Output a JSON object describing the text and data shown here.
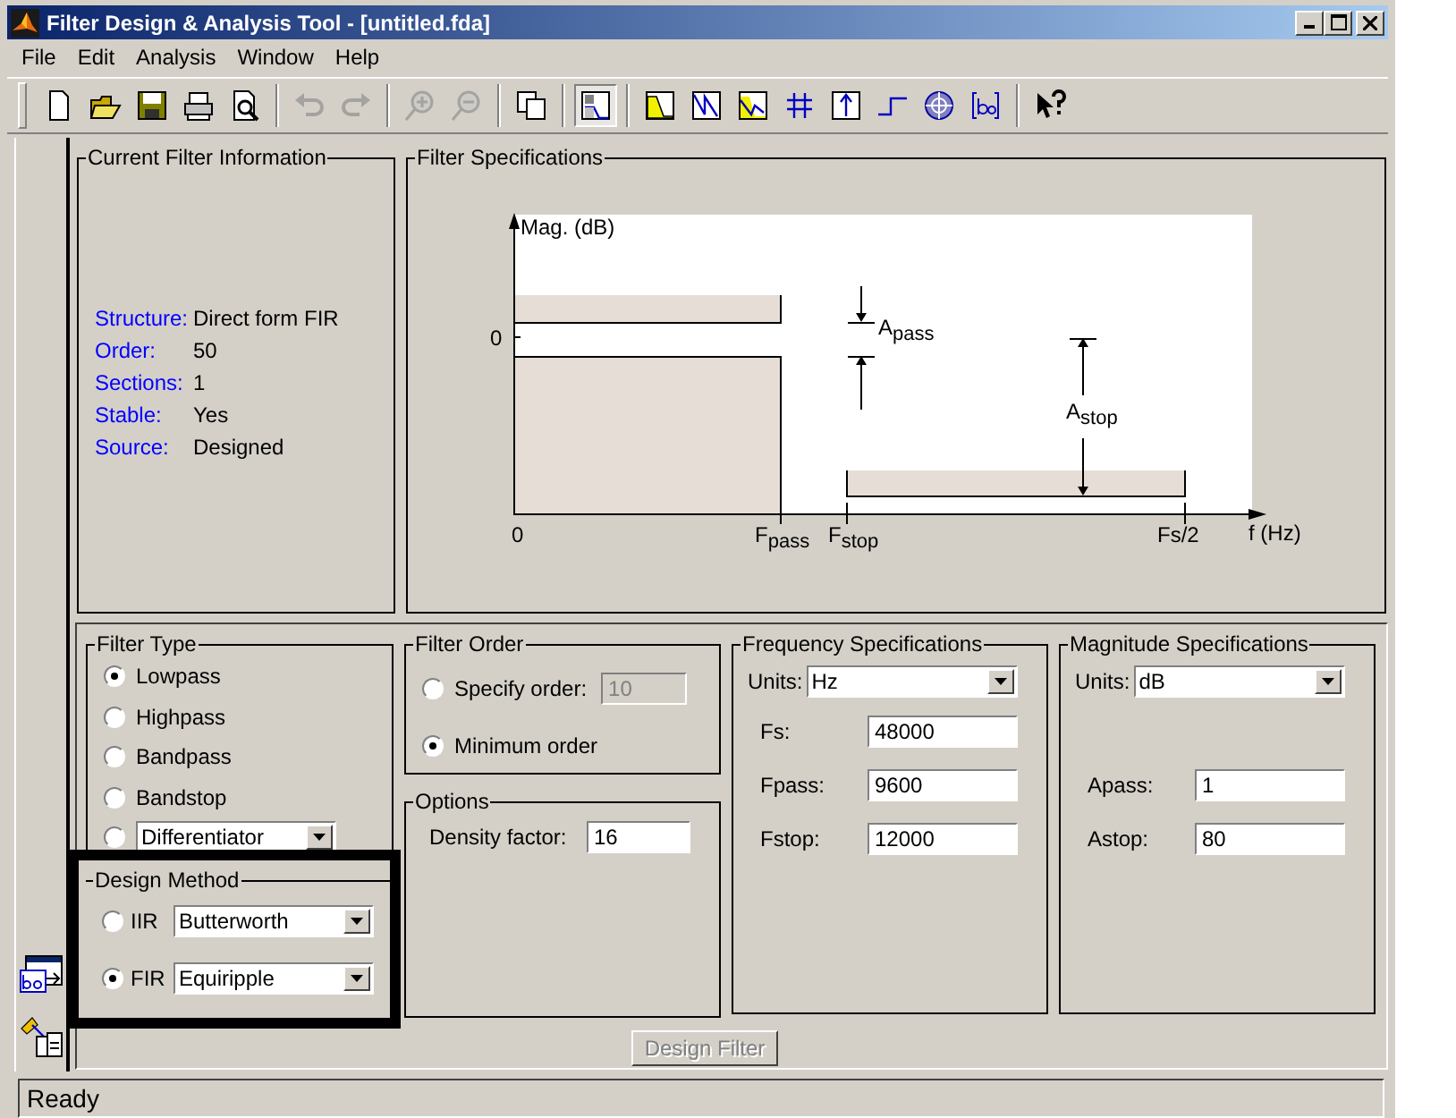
{
  "window": {
    "title": "Filter Design & Analysis Tool - [untitled.fda]"
  },
  "menu": [
    "File",
    "Edit",
    "Analysis",
    "Window",
    "Help"
  ],
  "toolbar_groups": [
    {
      "buttons": [
        {
          "kind": "new",
          "disabled": false,
          "pressed": false
        },
        {
          "kind": "open",
          "disabled": false,
          "pressed": false
        },
        {
          "kind": "save",
          "disabled": false,
          "pressed": false
        },
        {
          "kind": "print",
          "disabled": false,
          "pressed": false
        },
        {
          "kind": "preview",
          "disabled": false,
          "pressed": false
        }
      ]
    },
    {
      "buttons": [
        {
          "kind": "undo",
          "disabled": true,
          "pressed": false
        },
        {
          "kind": "redo",
          "disabled": true,
          "pressed": false
        }
      ]
    },
    {
      "buttons": [
        {
          "kind": "zoom_in",
          "disabled": true,
          "pressed": false
        },
        {
          "kind": "zoom_out",
          "disabled": true,
          "pressed": false
        }
      ]
    },
    {
      "buttons": [
        {
          "kind": "new_window",
          "disabled": false,
          "pressed": false
        }
      ]
    },
    {
      "buttons": [
        {
          "kind": "design",
          "disabled": false,
          "pressed": true
        }
      ]
    },
    {
      "buttons": [
        {
          "kind": "magnitude",
          "disabled": false,
          "pressed": false
        },
        {
          "kind": "phase",
          "disabled": false,
          "pressed": false
        },
        {
          "kind": "mag_phase",
          "disabled": false,
          "pressed": false
        },
        {
          "kind": "group_delay",
          "disabled": false,
          "pressed": false
        },
        {
          "kind": "impulse",
          "disabled": false,
          "pressed": false
        },
        {
          "kind": "step",
          "disabled": false,
          "pressed": false
        },
        {
          "kind": "pole_zero",
          "disabled": false,
          "pressed": false
        },
        {
          "kind": "coefficients",
          "disabled": false,
          "pressed": false
        }
      ]
    },
    {
      "buttons": [
        {
          "kind": "whats_this",
          "disabled": false,
          "pressed": false
        }
      ]
    }
  ],
  "current_filter_info": {
    "title": "Current Filter Information",
    "rows": [
      {
        "label": "Structure:",
        "value": "Direct form FIR"
      },
      {
        "label": "Order:",
        "value": "50"
      },
      {
        "label": "Sections:",
        "value": "1"
      },
      {
        "label": "Stable:",
        "value": "Yes"
      },
      {
        "label": "Source:",
        "value": "Designed"
      }
    ]
  },
  "filter_specifications": {
    "title": "Filter Specifications",
    "diagram": {
      "magnitude_label": "Mag. (dB)",
      "zero_level": "0",
      "origin": "0",
      "fpass": "F$_{pass}$",
      "fstop": "F$_{stop}$",
      "nyquist": "Fs/2",
      "frequency_label": "f (Hz)",
      "apass": "A$_{pass}$",
      "astop": "A$_{stop}$"
    }
  },
  "filter_type": {
    "title": "Filter Type",
    "options": [
      {
        "kind": "radio",
        "label": "Lowpass",
        "selected": true
      },
      {
        "kind": "radio",
        "label": "Highpass",
        "selected": false
      },
      {
        "kind": "radio",
        "label": "Bandpass",
        "selected": false
      },
      {
        "kind": "radio",
        "label": "Bandstop",
        "selected": false
      },
      {
        "kind": "dropdown",
        "value": "Differentiator",
        "selected": false
      }
    ]
  },
  "design_method": {
    "title": "Design Method",
    "options": [
      {
        "label": "IIR",
        "value": "Butterworth",
        "selected": false
      },
      {
        "label": "FIR",
        "value": "Equiripple",
        "selected": true
      }
    ]
  },
  "filter_order": {
    "title": "Filter Order",
    "options": [
      {
        "label": "Specify order:",
        "value": "10",
        "selected": false,
        "disabled": true
      },
      {
        "label": "Minimum order",
        "selected": true
      }
    ]
  },
  "options": {
    "title": "Options",
    "fields": [
      {
        "label": "Density factor:",
        "value": "16"
      }
    ]
  },
  "frequency_specifications": {
    "title": "Frequency Specifications",
    "units": {
      "label": "Units:",
      "value": "Hz"
    },
    "fields": [
      {
        "label": "Fs:",
        "value": "48000"
      },
      {
        "label": "Fpass:",
        "value": "9600"
      },
      {
        "label": "Fstop:",
        "value": "12000"
      }
    ]
  },
  "magnitude_specifications": {
    "title": "Magnitude Specifications",
    "units": {
      "label": "Units:",
      "value": "dB"
    },
    "fields": [
      {
        "label": "Apass:",
        "value": "1"
      },
      {
        "label": "Astop:",
        "value": "80"
      }
    ]
  },
  "design_button": {
    "label": "Design Filter",
    "disabled": true
  },
  "status_bar": {
    "text": "Ready"
  }
}
